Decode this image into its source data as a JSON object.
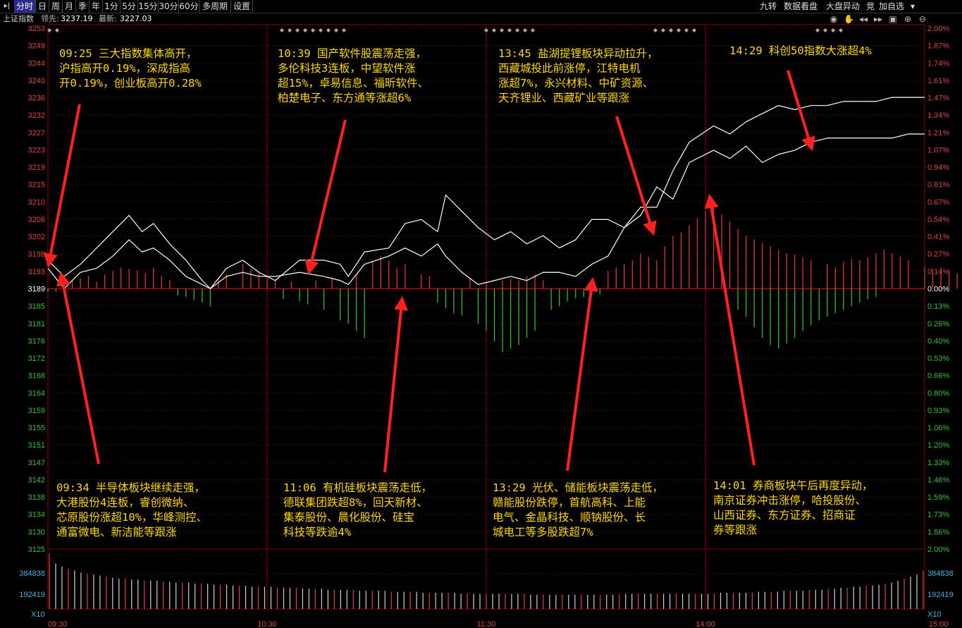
{
  "topbar": {
    "tabs": [
      "分时",
      "日",
      "周",
      "月",
      "季",
      "年",
      "1分",
      "5分",
      "15分",
      "30分",
      "60分",
      "多周期",
      "设置"
    ],
    "active_tab": "分时",
    "right_tabs": [
      "九转",
      "数据看盘",
      "大盘异动",
      "竞",
      "加自选"
    ]
  },
  "infobar": {
    "index_name": "上证指数",
    "lead_label": "领先:",
    "lead_value": "3237.19",
    "latest_label": "最新:",
    "latest_value": "3227.03"
  },
  "icons": [
    "eye-icon",
    "hand-icon",
    "rewind-icon",
    "fast-forward-icon",
    "lock-icon",
    "zoom-in-icon",
    "zoom-out-icon"
  ],
  "chart_data": {
    "type": "line",
    "title": "上证指数",
    "x_labels": [
      "09:30",
      "10:30",
      "11:30",
      "14:00",
      "15:00"
    ],
    "y_left_ticks": [
      "3253",
      "3249",
      "3244",
      "3240",
      "3236",
      "3232",
      "3227",
      "3223",
      "3219",
      "3215",
      "3210",
      "3206",
      "3202",
      "3198",
      "3193",
      "3189",
      "3185",
      "3181",
      "3176",
      "3172",
      "3168",
      "3164",
      "3159",
      "3155",
      "3151",
      "3147",
      "3142",
      "3138",
      "3134",
      "3130",
      "3125"
    ],
    "y_right_ticks": [
      "2.00%",
      "1.87%",
      "1.74%",
      "1.61%",
      "1.47%",
      "1.34%",
      "1.21%",
      "1.07%",
      "0.94%",
      "0.81%",
      "0.67%",
      "0.54%",
      "0.41%",
      "0.27%",
      "0.14%",
      "0.00%",
      "0.13%",
      "0.26%",
      "0.40%",
      "0.53%",
      "0.66%",
      "0.80%",
      "0.93%",
      "1.06%",
      "1.20%",
      "1.33%",
      "1.46%",
      "1.59%",
      "1.73%",
      "1.86%",
      "2.00%"
    ],
    "ylim": [
      3125,
      3253
    ],
    "prev_close": 3189,
    "volume_ticks": [
      "384838",
      "192419"
    ],
    "volume_unit": "X10",
    "series": [
      {
        "name": "最新",
        "color": "#ffffff",
        "points": [
          [
            0,
            3196
          ],
          [
            10,
            3192
          ],
          [
            20,
            3195
          ],
          [
            30,
            3199
          ],
          [
            40,
            3203
          ],
          [
            50,
            3207
          ],
          [
            58,
            3203
          ],
          [
            65,
            3205
          ],
          [
            75,
            3200
          ],
          [
            85,
            3196
          ],
          [
            95,
            3191
          ],
          [
            100,
            3189
          ],
          [
            110,
            3194
          ],
          [
            120,
            3196
          ],
          [
            130,
            3193
          ],
          [
            140,
            3191
          ],
          [
            155,
            3196
          ],
          [
            170,
            3196
          ],
          [
            180,
            3195
          ],
          [
            185,
            3192
          ],
          [
            195,
            3198
          ],
          [
            210,
            3199
          ],
          [
            220,
            3205
          ],
          [
            230,
            3206
          ],
          [
            240,
            3203
          ],
          [
            245,
            3212
          ],
          [
            255,
            3208
          ],
          [
            265,
            3204
          ],
          [
            275,
            3201
          ],
          [
            285,
            3203
          ],
          [
            295,
            3200
          ],
          [
            305,
            3202
          ],
          [
            315,
            3199
          ],
          [
            325,
            3201
          ],
          [
            335,
            3206
          ],
          [
            345,
            3206
          ],
          [
            355,
            3204
          ],
          [
            365,
            3209
          ],
          [
            375,
            3209
          ],
          [
            385,
            3218
          ],
          [
            395,
            3225
          ],
          [
            410,
            3229
          ],
          [
            420,
            3227
          ],
          [
            430,
            3230
          ],
          [
            440,
            3232
          ],
          [
            450,
            3234
          ],
          [
            460,
            3233
          ],
          [
            470,
            3234
          ],
          [
            480,
            3234
          ],
          [
            490,
            3235
          ],
          [
            500,
            3235
          ],
          [
            510,
            3235
          ],
          [
            520,
            3236
          ],
          [
            530,
            3236
          ],
          [
            540,
            3236
          ]
        ]
      },
      {
        "name": "领先",
        "color": "#ffffff",
        "points": [
          [
            0,
            3194
          ],
          [
            10,
            3189
          ],
          [
            20,
            3193
          ],
          [
            30,
            3194
          ],
          [
            40,
            3197
          ],
          [
            50,
            3201
          ],
          [
            58,
            3198
          ],
          [
            65,
            3199
          ],
          [
            75,
            3196
          ],
          [
            85,
            3192
          ],
          [
            95,
            3190
          ],
          [
            100,
            3189
          ],
          [
            110,
            3192
          ],
          [
            120,
            3193
          ],
          [
            130,
            3192
          ],
          [
            140,
            3192
          ],
          [
            155,
            3193
          ],
          [
            170,
            3192
          ],
          [
            180,
            3191
          ],
          [
            185,
            3190
          ],
          [
            195,
            3195
          ],
          [
            210,
            3197
          ],
          [
            220,
            3199
          ],
          [
            230,
            3197
          ],
          [
            240,
            3200
          ],
          [
            245,
            3197
          ],
          [
            255,
            3193
          ],
          [
            265,
            3190
          ],
          [
            275,
            3191
          ],
          [
            285,
            3192
          ],
          [
            295,
            3191
          ],
          [
            305,
            3193
          ],
          [
            315,
            3193
          ],
          [
            325,
            3192
          ],
          [
            335,
            3195
          ],
          [
            345,
            3197
          ],
          [
            355,
            3204
          ],
          [
            365,
            3207
          ],
          [
            375,
            3214
          ],
          [
            385,
            3211
          ],
          [
            395,
            3220
          ],
          [
            410,
            3223
          ],
          [
            420,
            3221
          ],
          [
            430,
            3224
          ],
          [
            440,
            3220
          ],
          [
            450,
            3222
          ],
          [
            460,
            3223
          ],
          [
            470,
            3225
          ],
          [
            480,
            3226
          ],
          [
            490,
            3226
          ],
          [
            500,
            3226
          ],
          [
            510,
            3226
          ],
          [
            520,
            3226
          ],
          [
            530,
            3227
          ],
          [
            540,
            3227
          ]
        ]
      }
    ],
    "bars_red": [
      [
        15,
        12
      ],
      [
        20,
        15
      ],
      [
        25,
        18
      ],
      [
        30,
        10
      ],
      [
        35,
        20
      ],
      [
        40,
        25
      ],
      [
        45,
        30
      ],
      [
        50,
        28
      ],
      [
        55,
        26
      ],
      [
        60,
        22
      ],
      [
        65,
        30
      ],
      [
        70,
        18
      ],
      [
        75,
        12
      ],
      [
        105,
        14
      ],
      [
        110,
        20
      ],
      [
        120,
        35
      ],
      [
        125,
        28
      ],
      [
        130,
        22
      ],
      [
        135,
        18
      ],
      [
        140,
        12
      ],
      [
        150,
        10
      ],
      [
        165,
        12
      ],
      [
        175,
        16
      ],
      [
        190,
        20
      ],
      [
        200,
        38
      ],
      [
        205,
        46
      ],
      [
        210,
        40
      ],
      [
        215,
        30
      ],
      [
        220,
        35
      ],
      [
        230,
        20
      ],
      [
        235,
        18
      ],
      [
        260,
        15
      ],
      [
        270,
        10
      ],
      [
        280,
        12
      ],
      [
        285,
        14
      ],
      [
        290,
        12
      ],
      [
        295,
        18
      ],
      [
        300,
        20
      ],
      [
        305,
        12
      ],
      [
        345,
        25
      ],
      [
        350,
        30
      ],
      [
        355,
        35
      ],
      [
        360,
        40
      ],
      [
        365,
        50
      ],
      [
        370,
        45
      ],
      [
        375,
        40
      ],
      [
        380,
        60
      ],
      [
        385,
        75
      ],
      [
        390,
        80
      ],
      [
        395,
        90
      ],
      [
        400,
        100
      ],
      [
        405,
        110
      ],
      [
        410,
        115
      ],
      [
        415,
        105
      ],
      [
        420,
        95
      ],
      [
        425,
        85
      ],
      [
        430,
        75
      ],
      [
        435,
        70
      ],
      [
        440,
        65
      ],
      [
        445,
        60
      ],
      [
        450,
        55
      ],
      [
        455,
        50
      ],
      [
        460,
        48
      ],
      [
        465,
        45
      ],
      [
        470,
        40
      ],
      [
        480,
        35
      ],
      [
        485,
        30
      ],
      [
        490,
        38
      ],
      [
        495,
        42
      ],
      [
        500,
        40
      ],
      [
        505,
        44
      ],
      [
        510,
        50
      ],
      [
        515,
        56
      ],
      [
        520,
        50
      ],
      [
        525,
        46
      ],
      [
        530,
        40
      ],
      [
        540,
        30
      ],
      [
        545,
        28
      ],
      [
        550,
        30
      ],
      [
        555,
        26
      ],
      [
        560,
        22
      ],
      [
        565,
        20
      ],
      [
        570,
        18
      ],
      [
        575,
        16
      ],
      [
        580,
        12
      ],
      [
        585,
        10
      ]
    ],
    "bars_green": [
      [
        0,
        5
      ],
      [
        5,
        4
      ],
      [
        10,
        6
      ],
      [
        80,
        10
      ],
      [
        85,
        12
      ],
      [
        90,
        16
      ],
      [
        95,
        20
      ],
      [
        100,
        25
      ],
      [
        145,
        15
      ],
      [
        155,
        18
      ],
      [
        160,
        22
      ],
      [
        170,
        30
      ],
      [
        180,
        45
      ],
      [
        185,
        50
      ],
      [
        190,
        60
      ],
      [
        195,
        70
      ],
      [
        240,
        20
      ],
      [
        245,
        28
      ],
      [
        250,
        35
      ],
      [
        255,
        38
      ],
      [
        265,
        50
      ],
      [
        270,
        60
      ],
      [
        275,
        75
      ],
      [
        280,
        90
      ],
      [
        285,
        85
      ],
      [
        290,
        80
      ],
      [
        295,
        70
      ],
      [
        300,
        60
      ],
      [
        310,
        30
      ],
      [
        315,
        25
      ],
      [
        320,
        18
      ],
      [
        325,
        14
      ],
      [
        330,
        12
      ],
      [
        335,
        10
      ],
      [
        340,
        8
      ],
      [
        425,
        30
      ],
      [
        430,
        40
      ],
      [
        435,
        55
      ],
      [
        440,
        70
      ],
      [
        445,
        80
      ],
      [
        450,
        85
      ],
      [
        455,
        78
      ],
      [
        460,
        70
      ],
      [
        465,
        60
      ],
      [
        470,
        52
      ],
      [
        475,
        45
      ],
      [
        480,
        40
      ],
      [
        485,
        35
      ],
      [
        490,
        30
      ],
      [
        495,
        25
      ],
      [
        500,
        20
      ],
      [
        505,
        15
      ],
      [
        510,
        12
      ]
    ],
    "volume": [
      55,
      45,
      42,
      40,
      38,
      36,
      35,
      34,
      33,
      32,
      31,
      30,
      30,
      29,
      29,
      28,
      28,
      28,
      27,
      27,
      26,
      26,
      26,
      25,
      25,
      25,
      24,
      24,
      24,
      23,
      23,
      23,
      22,
      22,
      22,
      22,
      21,
      21,
      21,
      21,
      20,
      20,
      20,
      20,
      19,
      19,
      19,
      19,
      19,
      18,
      18,
      18,
      18,
      18,
      17,
      17,
      17,
      17,
      17,
      16,
      16,
      16,
      16,
      16,
      16,
      15,
      15,
      15,
      15,
      15,
      15,
      15,
      15,
      15,
      15,
      15,
      14,
      14,
      14,
      14,
      14,
      14,
      14,
      14,
      14,
      14,
      14,
      14,
      14,
      14,
      14,
      15,
      15,
      15,
      15,
      15,
      15,
      15,
      15,
      15,
      15,
      15,
      15,
      15,
      15,
      15,
      16,
      16,
      16,
      16,
      16,
      16,
      17,
      17,
      17,
      17,
      18,
      18,
      18,
      18,
      19,
      19,
      19,
      20,
      20,
      21,
      21,
      22,
      22,
      23,
      23,
      24,
      25,
      26,
      28,
      30,
      32,
      34,
      38
    ]
  },
  "annotations": [
    {
      "id": "a1",
      "lines": [
        "09:25 三大指数集体高开，",
        "沪指高开0.19%，深成指高",
        "开0.19%，创业板高开0.28%"
      ]
    },
    {
      "id": "a2",
      "lines": [
        "10:39 国产软件股震荡走强，",
        "多伦科技3连板，中望软件涨",
        "超15%，卓易信息、福昕软件、",
        "柏楚电子、东方通等涨超6%"
      ]
    },
    {
      "id": "a3",
      "lines": [
        "13:45 盐湖提锂板块异动拉升，",
        "西藏城投此前涨停，江特电机",
        "涨超7%，永兴材料、中矿资源、",
        "天齐锂业、西藏矿业等跟涨"
      ]
    },
    {
      "id": "a4",
      "lines": [
        "14:29 科创50指数大涨超4%"
      ]
    },
    {
      "id": "a5",
      "lines": [
        "09:34 半导体板块继续走强，",
        "大港股份4连板，睿创微纳、",
        "芯原股份涨超10%，华峰测控、",
        "通富微电、新洁能等跟涨"
      ]
    },
    {
      "id": "a6",
      "lines": [
        "11:06 有机硅板块震荡走低，",
        "德联集团跌超8%，回天新材、",
        "集泰股份、晨化股份、硅宝",
        "科技等跌逾4%"
      ]
    },
    {
      "id": "a7",
      "lines": [
        "13:29 光伏、储能板块震荡走低，",
        "赣能股份跌停，首航高科、上能",
        "电气、金晶科技、顺钠股份、长",
        "城电工等多股跌超7%"
      ]
    },
    {
      "id": "a8",
      "lines": [
        "14:01 券商板块午后再度异动，",
        "南京证券冲击涨停，哈投股份、",
        "山西证券、东方证券、招商证",
        "券等跟涨"
      ]
    }
  ]
}
